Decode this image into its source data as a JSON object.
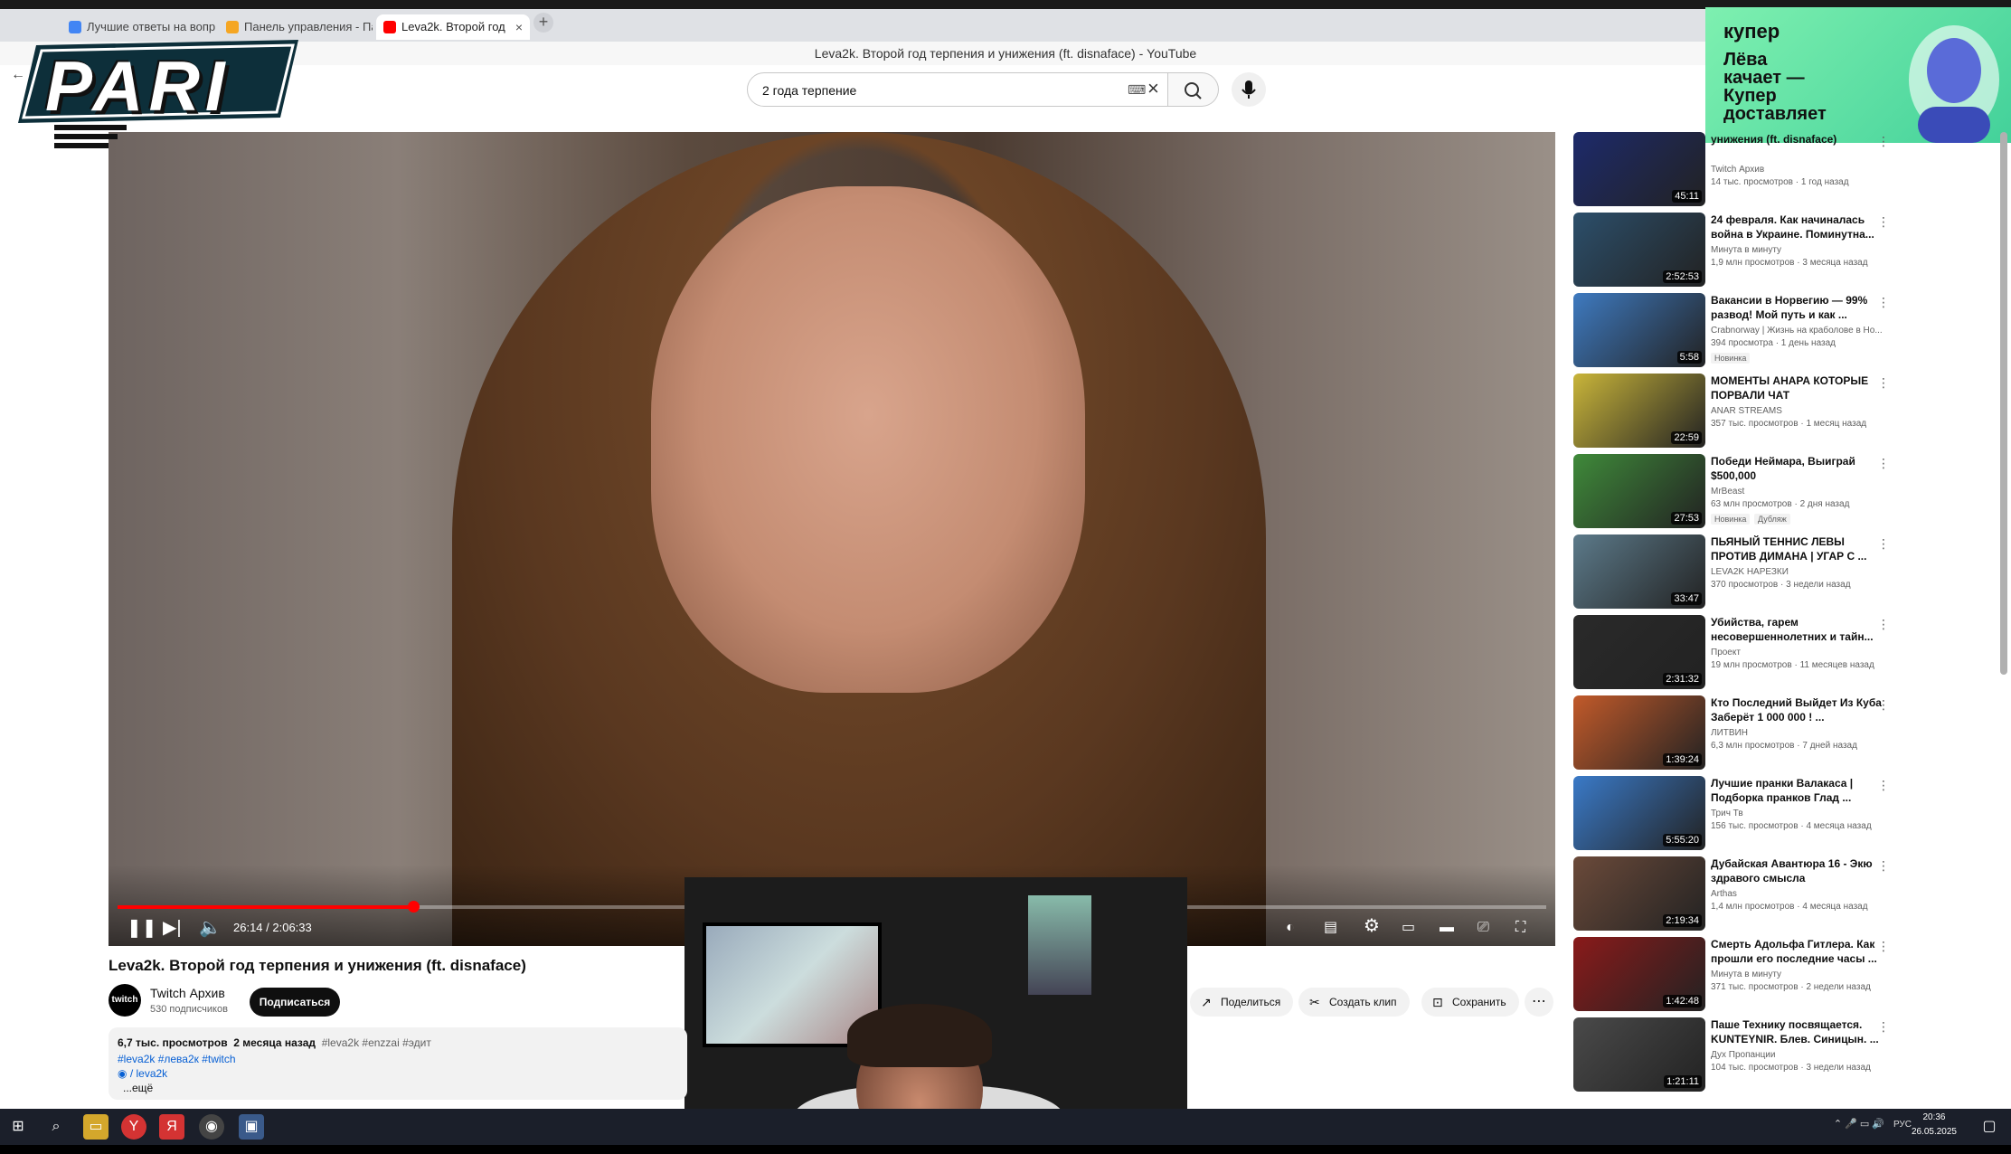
{
  "browser": {
    "tabs": [
      {
        "label": "Лучшие ответы на вопро",
        "active": false
      },
      {
        "label": "Панель управления - Па",
        "active": false
      },
      {
        "label": "Leva2k. Второй год",
        "active": true
      }
    ],
    "window_title": "Leva2k. Второй год терпения и унижения (ft. disnaface) - YouTube"
  },
  "search": {
    "value": "2 года терпение"
  },
  "overlay": {
    "logo_text": "PARI",
    "ad": {
      "brand": "купер",
      "line1": "Лёва",
      "line2": "качает —",
      "line3": "Купер",
      "line4": "доставляет"
    }
  },
  "player": {
    "current_time": "26:14",
    "duration": "2:06:33",
    "time_display": "26:14 / 2:06:33",
    "progress": 0.207
  },
  "video": {
    "title": "Leva2k. Второй год терпения и унижения (ft. disnaface)",
    "channel": "Twitch Архив",
    "subscribers": "530 подписчиков",
    "subscribe_label": "Подписаться",
    "actions": {
      "share": "Поделиться",
      "clip": "Создать клип",
      "save": "Сохранить"
    },
    "views": "6,7 тыс. просмотров",
    "date": "2 месяца назад",
    "hashtags": "#leva2k #enzzai #эдит",
    "tags2": "#leva2k #лева2к #twitch",
    "link": "/ leva2k",
    "more": "...ещё"
  },
  "recommendations": [
    {
      "title": "унижения (ft. disnaface)",
      "channel": "Twitch Архив",
      "meta": "14 тыс. просмотров · 1 год назад",
      "duration": "45:11",
      "color": "#1d2a6b"
    },
    {
      "title": "24 февраля. Как начиналась война в Украине. Поминутна...",
      "channel": "Минута в минуту",
      "meta": "1,9 млн просмотров · 3 месяца назад",
      "duration": "2:52:53",
      "color": "#2c4f6b"
    },
    {
      "title": "Вакансии в Норвегию — 99% развод! Мой путь и как ...",
      "channel": "Crabnorway | Жизнь на краболове в Но...",
      "meta": "394 просмотра · 1 день назад",
      "duration": "5:58",
      "color": "#3e7ac0",
      "badge": "Новинка"
    },
    {
      "title": "МОМЕНТЫ АНАРА КОТОРЫЕ ПОРВАЛИ ЧАТ",
      "channel": "ANAR STREAMS",
      "meta": "357 тыс. просмотров · 1 месяц назад",
      "duration": "22:59",
      "color": "#c9b53a"
    },
    {
      "title": "Победи Неймара, Выиграй $500,000",
      "channel": "MrBeast",
      "meta": "63 млн просмотров · 2 дня назад",
      "duration": "27:53",
      "color": "#3f8a3a",
      "badge": "Новинка",
      "badge2": "Дубляж"
    },
    {
      "title": "ПЬЯНЫЙ ТЕННИС ЛЕВЫ ПРОТИВ ДИМАНА | УГАР С ...",
      "channel": "LEVA2K НАРЕЗКИ",
      "meta": "370 просмотров · 3 недели назад",
      "duration": "33:47",
      "color": "#5c7a8a"
    },
    {
      "title": "Убийства, гарем несовершеннолетних и тайн...",
      "channel": "Проект",
      "meta": "19 млн просмотров · 11 месяцев назад",
      "duration": "2:31:32",
      "color": "#2a2a2a"
    },
    {
      "title": "Кто Последний Выйдет Из Куба Заберёт 1 000 000 ! ...",
      "channel": "ЛИТВИН",
      "meta": "6,3 млн просмотров · 7 дней назад",
      "duration": "1:39:24",
      "color": "#c25a2a"
    },
    {
      "title": "Лучшие пранки Валакаса | Подборка пранков Глад ...",
      "channel": "Трич Тв",
      "meta": "156 тыс. просмотров · 4 месяца назад",
      "duration": "5:55:20",
      "color": "#3a7ac8"
    },
    {
      "title": "Дубайская Авантюра 16 - Экю здравого смысла",
      "channel": "Arthas",
      "meta": "1,4 млн просмотров · 4 месяца назад",
      "duration": "2:19:34",
      "color": "#6b4a3a"
    },
    {
      "title": "Смерть Адольфа Гитлера. Как прошли его последние часы ...",
      "channel": "Минута в минуту",
      "meta": "371 тыс. просмотров · 2 недели назад",
      "duration": "1:42:48",
      "color": "#8a1a1a"
    },
    {
      "title": "Паше Технику посвящается. KUNTEYNIR. Блев. Синицын. ...",
      "channel": "Дух Пропанции",
      "meta": "104 тыс. просмотров · 3 недели назад",
      "duration": "1:21:11",
      "color": "#4a4a4a"
    }
  ],
  "taskbar": {
    "lang": "РУС",
    "time": "20:36",
    "date": "26.05.2025"
  }
}
